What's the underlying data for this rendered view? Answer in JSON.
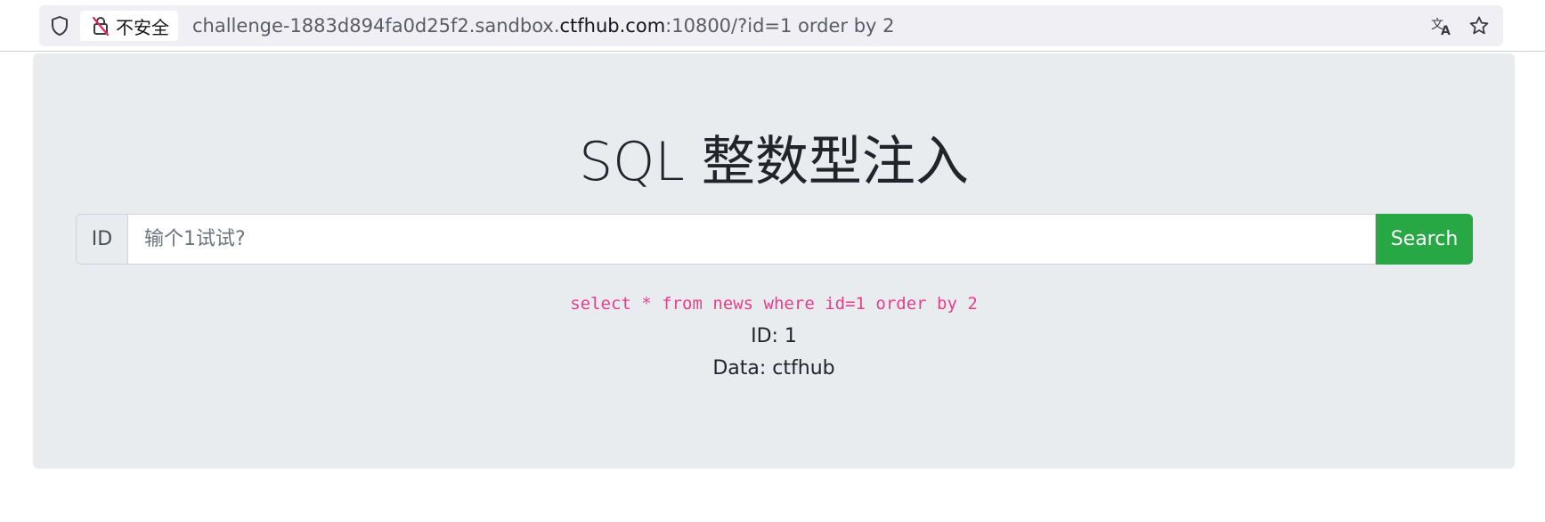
{
  "browser": {
    "security_label": "不安全",
    "url": {
      "prefix": "challenge-1883d894fa0d25f2.sandbox.",
      "domain": "ctfhub.com",
      "suffix": ":10800/?id=1 order by 2"
    },
    "icons": [
      "shield-icon",
      "insecure-lock-icon",
      "translate-icon",
      "bookmark-star-icon"
    ]
  },
  "page": {
    "heading": "SQL 整数型注入",
    "form": {
      "prepend_label": "ID",
      "input_value": "",
      "input_placeholder": "输个1试试?",
      "search_label": "Search"
    },
    "query": "select * from news where id=1 order by 2",
    "result": {
      "id_line": "ID: 1",
      "data_line": "Data: ctfhub"
    }
  },
  "colors": {
    "jumbotron_bg": "#e9ecef",
    "search_button": "#28a745",
    "query_text": "#e83e8c",
    "heading_text": "#212529"
  }
}
